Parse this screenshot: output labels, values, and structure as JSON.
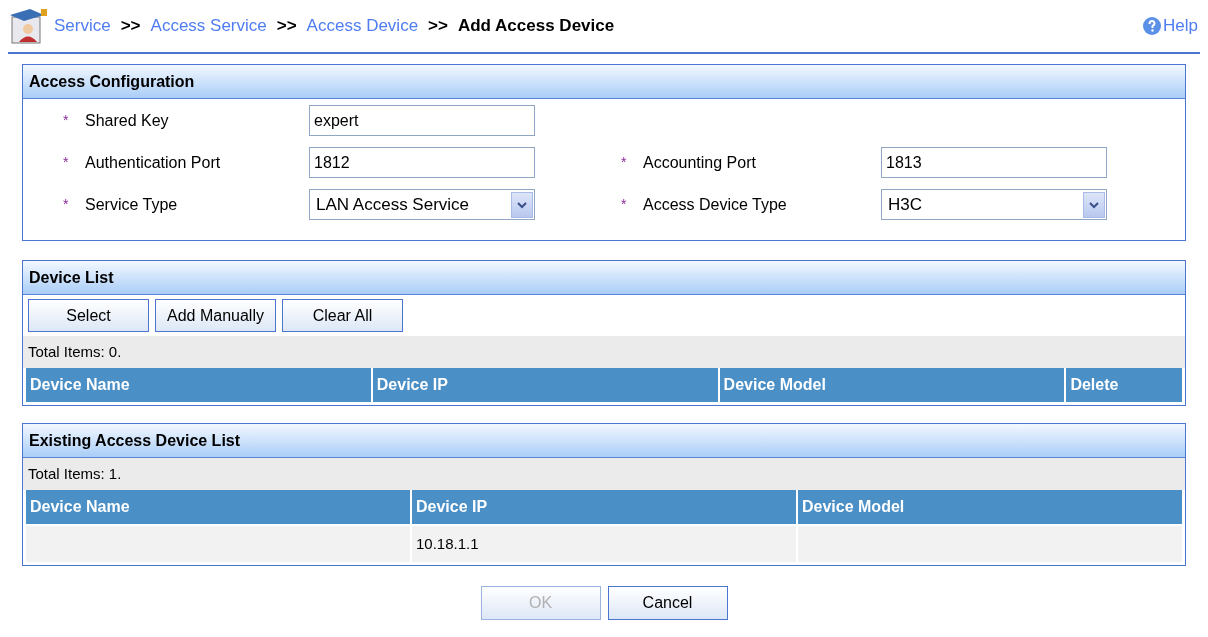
{
  "breadcrumb": [
    {
      "label": "Service",
      "current": false
    },
    {
      "label": "Access Service",
      "current": false
    },
    {
      "label": "Access Device",
      "current": false
    },
    {
      "label": "Add Access Device",
      "current": true
    }
  ],
  "separator": ">>",
  "help": "Help",
  "access_configuration": {
    "title": "Access Configuration",
    "required_mark": "*",
    "rows": [
      [
        {
          "label": "Shared Key",
          "kind": "text",
          "value": "expert"
        }
      ],
      [
        {
          "label": "Authentication Port",
          "kind": "text",
          "value": "1812"
        },
        {
          "label": "Accounting Port",
          "kind": "text",
          "value": "1813"
        }
      ],
      [
        {
          "label": "Service Type",
          "kind": "select",
          "value": "LAN Access Service"
        },
        {
          "label": "Access Device Type",
          "kind": "select",
          "value": "H3C"
        }
      ]
    ]
  },
  "device_list": {
    "title": "Device List",
    "buttons": [
      "Select",
      "Add Manually",
      "Clear All"
    ],
    "total": "Total Items: 0.",
    "columns": [
      "Device Name",
      "Device IP",
      "Device Model",
      "Delete"
    ]
  },
  "existing_list": {
    "title": "Existing Access Device List",
    "total": "Total Items: 1.",
    "columns": [
      "Device Name",
      "Device IP",
      "Device Model"
    ],
    "rows": [
      [
        "",
        "10.18.1.1",
        ""
      ]
    ]
  },
  "actions": [
    {
      "label": "OK",
      "disabled": true
    },
    {
      "label": "Cancel",
      "disabled": false
    }
  ]
}
